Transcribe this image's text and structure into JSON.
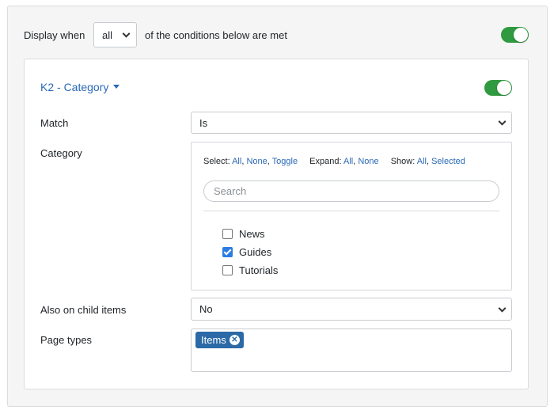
{
  "header": {
    "display_when_label": "Display when",
    "match_mode_value": "all",
    "conditions_suffix": "of the conditions below are met",
    "enabled": true
  },
  "condition": {
    "title": "K2 - Category",
    "enabled": true,
    "match": {
      "label": "Match",
      "value": "Is"
    },
    "category": {
      "label": "Category",
      "toolbar": {
        "select_label": "Select:",
        "select_all": "All",
        "select_none": "None",
        "select_toggle": "Toggle",
        "expand_label": "Expand:",
        "expand_all": "All",
        "expand_none": "None",
        "show_label": "Show:",
        "show_all": "All",
        "show_selected": "Selected"
      },
      "search_placeholder": "Search",
      "items": [
        {
          "label": "News",
          "checked": false
        },
        {
          "label": "Guides",
          "checked": true
        },
        {
          "label": "Tutorials",
          "checked": false
        }
      ]
    },
    "child_items": {
      "label": "Also on child items",
      "value": "No"
    },
    "page_types": {
      "label": "Page types",
      "tags": [
        "Items"
      ]
    }
  },
  "colors": {
    "accent": "#2a69b8",
    "toggle_on": "#2f9a3f",
    "tag_bg": "#2b6aa6",
    "checkbox_on": "#2b7de1"
  }
}
